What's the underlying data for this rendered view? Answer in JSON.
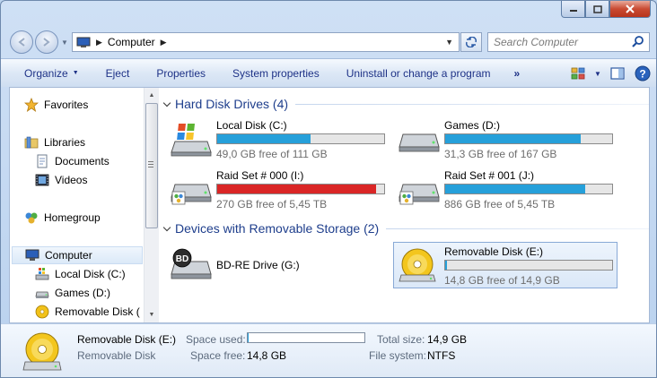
{
  "window": {
    "min_label": "▭",
    "max_label": "◻",
    "close_label": "✕"
  },
  "address": {
    "path_item": "Computer"
  },
  "search": {
    "placeholder": "Search Computer"
  },
  "commands": [
    {
      "label": "Organize",
      "dropdown": true
    },
    {
      "label": "Eject",
      "dropdown": false
    },
    {
      "label": "Properties",
      "dropdown": false
    },
    {
      "label": "System properties",
      "dropdown": false
    },
    {
      "label": "Uninstall or change a program",
      "dropdown": false
    }
  ],
  "commands_more": "»",
  "nav": {
    "favorites": "Favorites",
    "libraries": "Libraries",
    "documents": "Documents",
    "videos": "Videos",
    "homegroup": "Homegroup",
    "computer": "Computer",
    "local_disk": "Local Disk (C:)",
    "games": "Games (D:)",
    "removable": "Removable Disk ("
  },
  "groups": {
    "hdd_title": "Hard Disk Drives (4)",
    "removable_title": "Devices with Removable Storage (2)"
  },
  "drives": [
    {
      "name": "Local Disk (C:)",
      "free_text": "49,0 GB free of 111 GB",
      "used_fraction": 0.56,
      "bar_color": "#26a0da",
      "icon": "windows-drive-icon"
    },
    {
      "name": "Games (D:)",
      "free_text": "31,3 GB free of 167 GB",
      "used_fraction": 0.81,
      "bar_color": "#26a0da",
      "icon": "hard-drive-icon"
    },
    {
      "name": "Raid Set # 000 (I:)",
      "free_text": "270 GB free of 5,45 TB",
      "used_fraction": 0.95,
      "bar_color": "#da2626",
      "icon": "shared-drive-icon"
    },
    {
      "name": "Raid Set # 001 (J:)",
      "free_text": "886 GB free of 5,45 TB",
      "used_fraction": 0.84,
      "bar_color": "#26a0da",
      "icon": "shared-drive-icon"
    }
  ],
  "removable": [
    {
      "name": "BD-RE Drive (G:)",
      "icon": "bd-drive-icon"
    },
    {
      "name": "Removable Disk (E:)",
      "free_text": "14,8 GB free of 14,9 GB",
      "used_fraction": 0.01,
      "bar_color": "#26a0da",
      "icon": "removable-disk-icon"
    }
  ],
  "details": {
    "name": "Removable Disk (E:)",
    "type": "Removable Disk",
    "space_used_label": "Space used:",
    "space_free_label": "Space free:",
    "space_free_value": "14,8 GB",
    "total_size_label": "Total size:",
    "total_size_value": "14,9 GB",
    "file_system_label": "File system:",
    "file_system_value": "NTFS",
    "used_fraction": 0.01
  }
}
